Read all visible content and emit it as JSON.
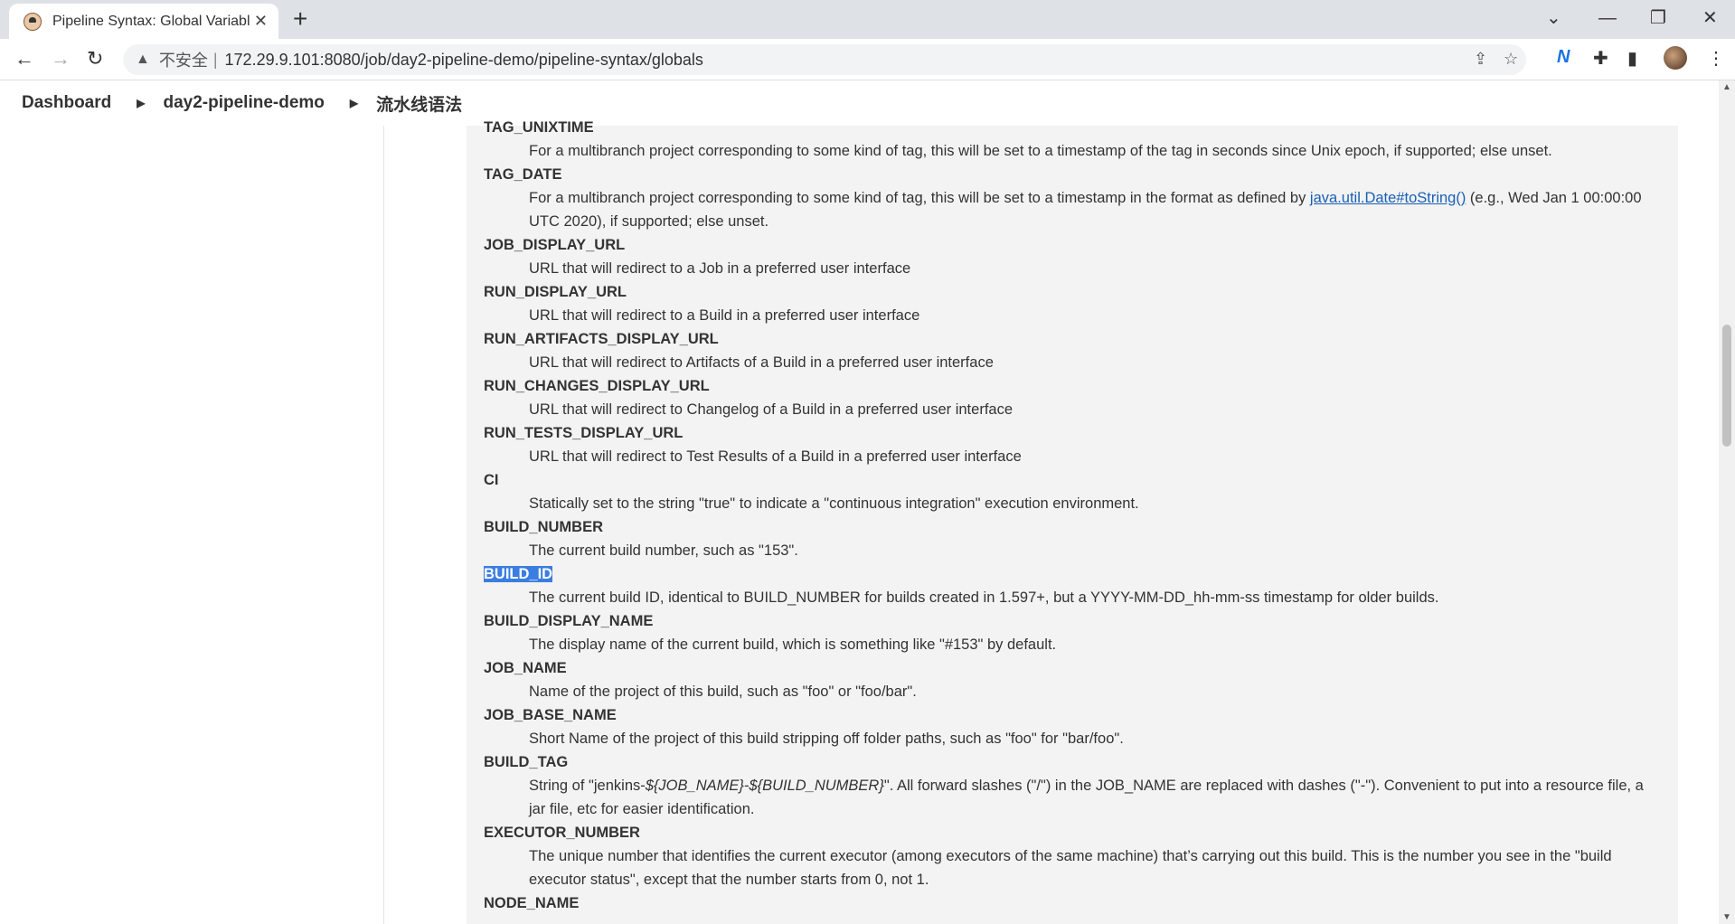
{
  "browser": {
    "tab_title": "Pipeline Syntax: Global Variabl",
    "insecure_label": "不安全",
    "url": "172.29.9.101:8080/job/day2-pipeline-demo/pipeline-syntax/globals"
  },
  "breadcrumb": {
    "items": [
      "Dashboard",
      "day2-pipeline-demo",
      "流水线语法"
    ]
  },
  "doc": {
    "entries": [
      {
        "term": "TAG_UNIXTIME",
        "desc": "For a multibranch project corresponding to some kind of tag, this will be set to a timestamp of the tag in seconds since Unix epoch, if supported; else unset."
      },
      {
        "term": "TAG_DATE",
        "desc_pre": "For a multibranch project corresponding to some kind of tag, this will be set to a timestamp in the format as defined by ",
        "desc_link": "java.util.Date#toString()",
        "desc_post": " (e.g., Wed Jan 1 00:00:00 UTC 2020), if supported; else unset."
      },
      {
        "term": "JOB_DISPLAY_URL",
        "desc": "URL that will redirect to a Job in a preferred user interface"
      },
      {
        "term": "RUN_DISPLAY_URL",
        "desc": "URL that will redirect to a Build in a preferred user interface"
      },
      {
        "term": "RUN_ARTIFACTS_DISPLAY_URL",
        "desc": "URL that will redirect to Artifacts of a Build in a preferred user interface"
      },
      {
        "term": "RUN_CHANGES_DISPLAY_URL",
        "desc": "URL that will redirect to Changelog of a Build in a preferred user interface"
      },
      {
        "term": "RUN_TESTS_DISPLAY_URL",
        "desc": "URL that will redirect to Test Results of a Build in a preferred user interface"
      },
      {
        "term": "CI",
        "desc": "Statically set to the string \"true\" to indicate a \"continuous integration\" execution environment."
      },
      {
        "term": "BUILD_NUMBER",
        "desc": "The current build number, such as \"153\"."
      },
      {
        "term": "BUILD_ID",
        "desc": "The current build ID, identical to BUILD_NUMBER for builds created in 1.597+, but a YYYY-MM-DD_hh-mm-ss timestamp for older builds."
      },
      {
        "term": "BUILD_DISPLAY_NAME",
        "desc": "The display name of the current build, which is something like \"#153\" by default."
      },
      {
        "term": "JOB_NAME",
        "desc": "Name of the project of this build, such as \"foo\" or \"foo/bar\"."
      },
      {
        "term": "JOB_BASE_NAME",
        "desc": "Short Name of the project of this build stripping off folder paths, such as \"foo\" for \"bar/foo\"."
      },
      {
        "term": "BUILD_TAG",
        "desc_pre": "String of \"jenkins-",
        "desc_em": "${JOB_NAME}-${BUILD_NUMBER}",
        "desc_post": "\". All forward slashes (\"/\") in the JOB_NAME are replaced with dashes (\"-\"). Convenient to put into a resource file, a jar file, etc for easier identification."
      },
      {
        "term": "EXECUTOR_NUMBER",
        "desc": "The unique number that identifies the current executor (among executors of the same machine) that’s carrying out this build. This is the number you see in the \"build executor status\", except that the number starts from 0, not 1."
      },
      {
        "term": "NODE_NAME",
        "desc": ""
      }
    ]
  }
}
